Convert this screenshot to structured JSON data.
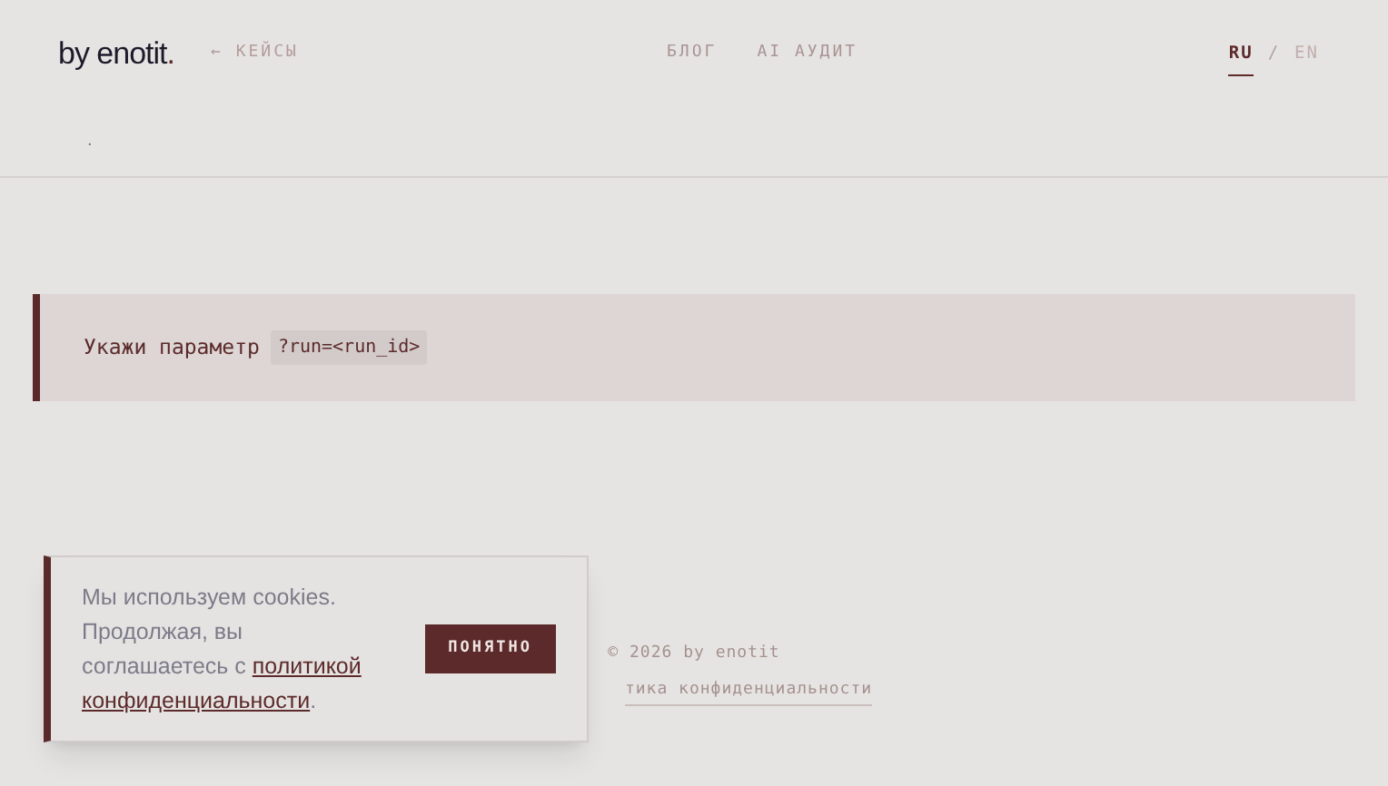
{
  "header": {
    "logo": "by enotit",
    "logo_dot": ".",
    "back_link": "← КЕЙСЫ",
    "nav": [
      {
        "label": "БЛОГ"
      },
      {
        "label": "AI АУДИТ"
      }
    ],
    "languages": [
      {
        "label": "RU",
        "selected": true
      },
      {
        "label": "EN",
        "selected": false
      }
    ],
    "language_separator": "/"
  },
  "breadcrumb": ".",
  "notice": {
    "text": "Укажи параметр",
    "code": "?run=<run_id>"
  },
  "footer": {
    "copyright": "© 2026 by enotit",
    "link": "тика конфиденциальности"
  },
  "cookie_banner": {
    "text": "Мы используем cookies. Продолжая, вы соглашаетесь с",
    "link": "политикой конфиденциальности",
    "end": ".",
    "button": "ПОНЯТНО"
  }
}
